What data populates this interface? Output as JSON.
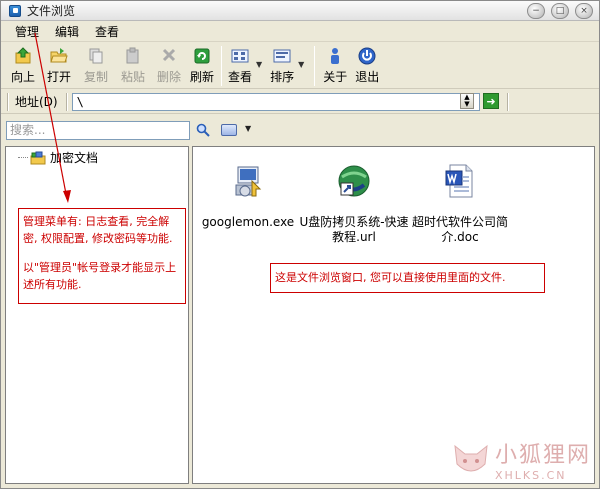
{
  "window": {
    "title": "文件浏览",
    "controls": [
      "−",
      "□",
      "×"
    ]
  },
  "menu": {
    "items": [
      "管理",
      "编辑",
      "查看"
    ]
  },
  "toolbar": {
    "up": "向上",
    "open": "打开",
    "copy": "复制",
    "paste": "粘贴",
    "delete": "删除",
    "refresh": "刷新",
    "view": "查看",
    "sort": "排序",
    "about": "关于",
    "exit": "退出"
  },
  "address": {
    "label": "地址(D)",
    "value": "\\"
  },
  "search": {
    "placeholder": "搜索..."
  },
  "tree": {
    "root": "加密文档"
  },
  "files": [
    {
      "name": "googlemon.exe",
      "icon": "installer-icon"
    },
    {
      "name": "U盘防拷贝系统-快速教程.url",
      "icon": "url-icon"
    },
    {
      "name": "超时代软件公司简介.doc",
      "icon": "word-doc-icon"
    }
  ],
  "annotations": {
    "menu_note": "管理菜单有: 日志查看, 完全解密, 权限配置, 修改密码等功能.",
    "menu_note_2": "以\"管理员\"帐号登录才能显示上述所有功能.",
    "browse_note": "这是文件浏览窗口, 您可以直接使用里面的文件."
  },
  "watermark": {
    "main": "小狐狸网",
    "sub": "XHLKS.CN"
  },
  "colors": {
    "annotation": "#cc0000",
    "window_bg": "#ece9d8"
  }
}
